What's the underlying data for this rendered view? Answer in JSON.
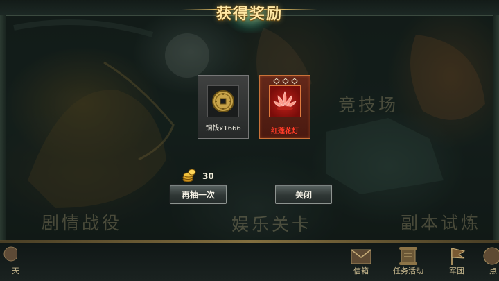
{
  "dialog": {
    "title": "获得奖励",
    "rewards": [
      {
        "label": "铜钱x1666",
        "icon": "copper-coin-icon",
        "rarity_color": "#808080"
      },
      {
        "label": "红莲花灯",
        "icon": "red-lotus-lamp-icon",
        "rarity_color": "#ff3b27",
        "gem_slots": 3
      }
    ],
    "cost": {
      "icon": "gold-coins-icon",
      "amount": "30"
    },
    "buttons": {
      "redraw": "再抽一次",
      "close": "关闭"
    }
  },
  "background": {
    "areas": {
      "arena": "竞技场",
      "story": "剧情战役",
      "entertainment": "娱乐关卡",
      "dungeon": "副本试炼"
    }
  },
  "bottom_nav": {
    "left_fragment": "天",
    "mail": "信箱",
    "tasks": "任务活动",
    "legion": "军团",
    "right_fragment": "点"
  },
  "colors": {
    "title_gold": "#ffe7a4",
    "rare_red": "#ff3b27",
    "nav_text": "#c9b98f"
  }
}
